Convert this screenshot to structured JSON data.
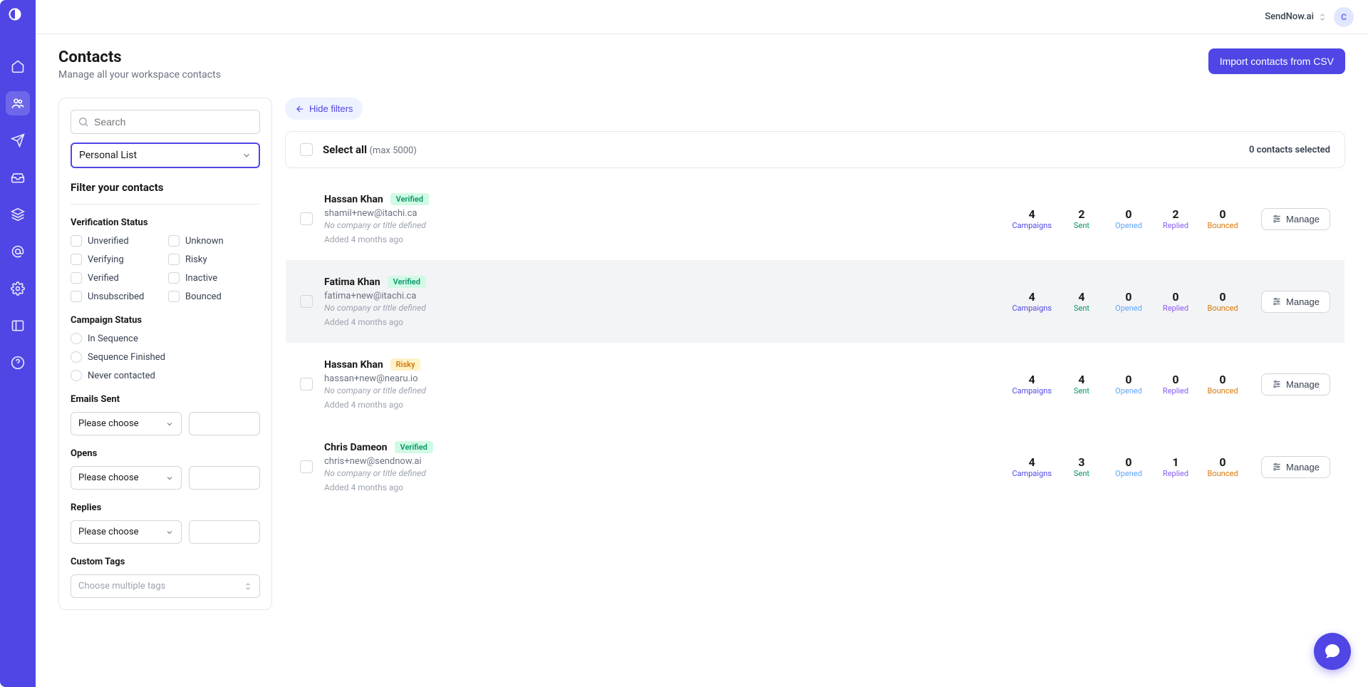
{
  "topbar": {
    "workspace": "SendNow.ai",
    "avatar_initial": "C"
  },
  "page": {
    "title": "Contacts",
    "subtitle": "Manage all your workspace contacts",
    "import_button": "Import contacts from CSV"
  },
  "filters": {
    "search_placeholder": "Search",
    "list_select": "Personal List",
    "filter_heading": "Filter your contacts",
    "verification_heading": "Verification Status",
    "verification_options": [
      "Unverified",
      "Unknown",
      "Verifying",
      "Risky",
      "Verified",
      "Inactive",
      "Unsubscribed",
      "Bounced"
    ],
    "campaign_heading": "Campaign Status",
    "campaign_options": [
      "In Sequence",
      "Sequence Finished",
      "Never contacted"
    ],
    "emails_sent_heading": "Emails Sent",
    "opens_heading": "Opens",
    "replies_heading": "Replies",
    "please_choose": "Please choose",
    "custom_tags_heading": "Custom Tags",
    "tags_placeholder": "Choose multiple tags"
  },
  "list": {
    "hide_filters": "Hide filters",
    "select_all": "Select all",
    "select_all_sub": "(max 5000)",
    "selected_count": "0 contacts selected",
    "stat_labels": {
      "campaigns": "Campaigns",
      "sent": "Sent",
      "opened": "Opened",
      "replied": "Replied",
      "bounced": "Bounced"
    },
    "manage": "Manage",
    "no_company": "No company or title defined"
  },
  "contacts": [
    {
      "name": "Hassan Khan",
      "badge": "Verified",
      "badge_class": "verified",
      "email": "shamil+new@itachi.ca",
      "added": "Added 4 months ago",
      "stats": {
        "campaigns": "4",
        "sent": "2",
        "opened": "0",
        "replied": "2",
        "bounced": "0"
      },
      "hover": false
    },
    {
      "name": "Fatima Khan",
      "badge": "Verified",
      "badge_class": "verified",
      "email": "fatima+new@itachi.ca",
      "added": "Added 4 months ago",
      "stats": {
        "campaigns": "4",
        "sent": "4",
        "opened": "0",
        "replied": "0",
        "bounced": "0"
      },
      "hover": true
    },
    {
      "name": "Hassan Khan",
      "badge": "Risky",
      "badge_class": "risky",
      "email": "hassan+new@nearu.io",
      "added": "Added 4 months ago",
      "stats": {
        "campaigns": "4",
        "sent": "4",
        "opened": "0",
        "replied": "0",
        "bounced": "0"
      },
      "hover": false
    },
    {
      "name": "Chris Dameon",
      "badge": "Verified",
      "badge_class": "verified",
      "email": "chris+new@sendnow.ai",
      "added": "Added 4 months ago",
      "stats": {
        "campaigns": "4",
        "sent": "3",
        "opened": "0",
        "replied": "1",
        "bounced": "0"
      },
      "hover": false
    }
  ]
}
